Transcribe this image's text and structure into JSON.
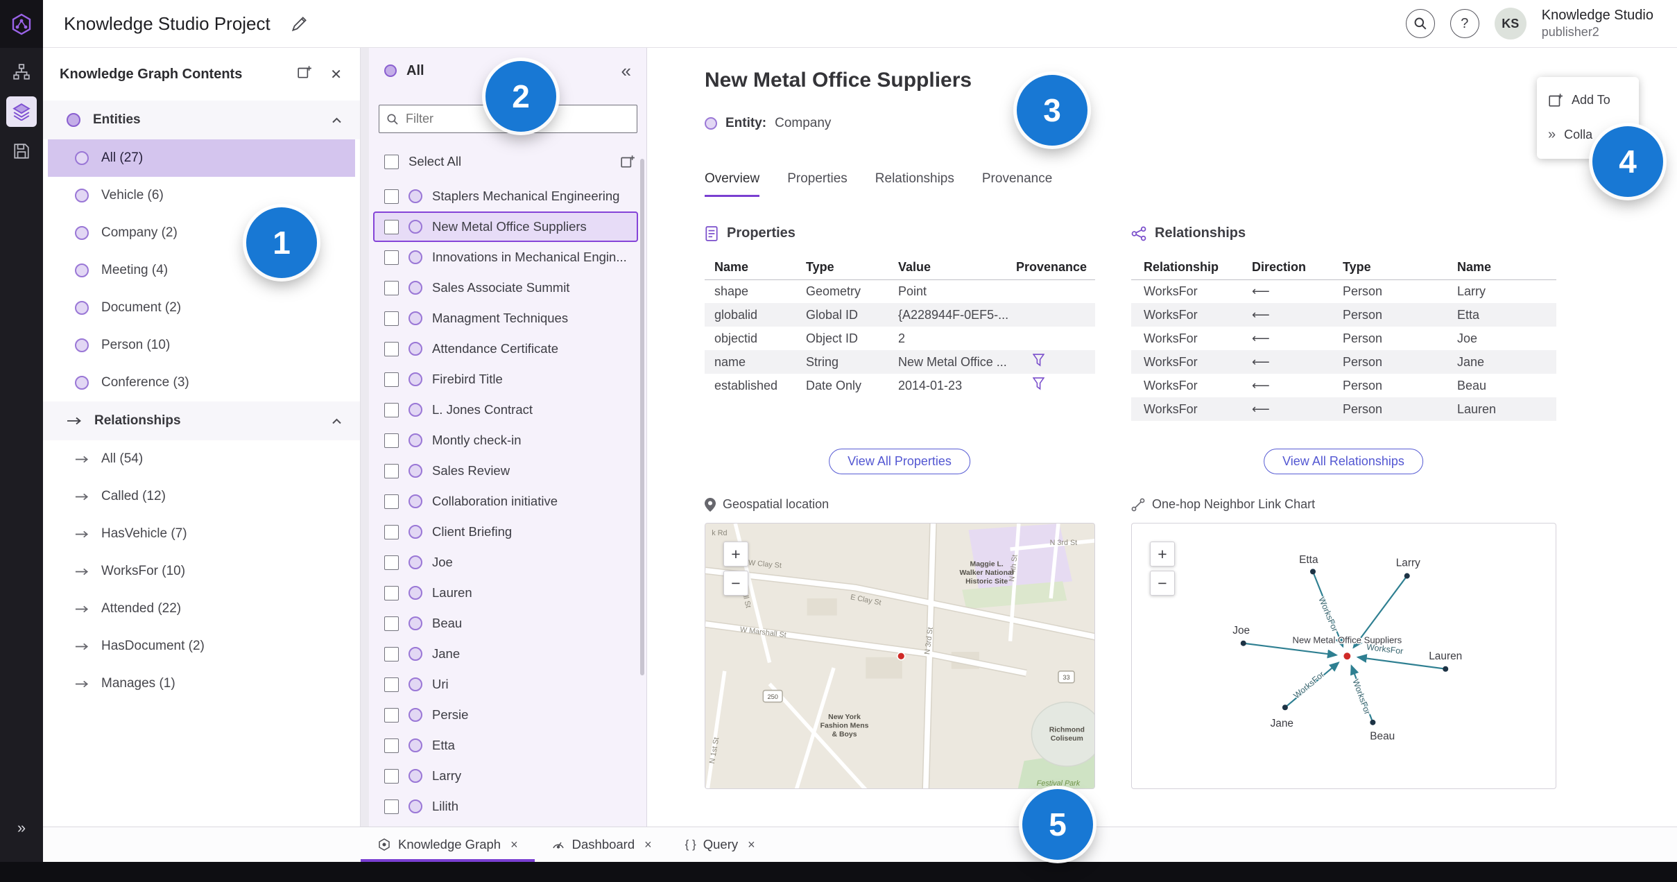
{
  "icons": {
    "collapse_left": "«",
    "expand_right": "»",
    "close": "✕",
    "help": "?",
    "zoom_in": "+",
    "zoom_out": "−",
    "tab_close": "×",
    "braces": "{ }"
  },
  "topbar": {
    "title": "Knowledge Studio Project",
    "avatar_initials": "KS",
    "user_name": "Knowledge Studio",
    "user_role": "publisher2"
  },
  "contents_panel": {
    "title": "Knowledge Graph Contents",
    "entities_label": "Entities",
    "entities": [
      {
        "label": "All (27)"
      },
      {
        "label": "Vehicle (6)"
      },
      {
        "label": "Company (2)"
      },
      {
        "label": "Meeting (4)"
      },
      {
        "label": "Document (2)"
      },
      {
        "label": "Person (10)"
      },
      {
        "label": "Conference (3)"
      }
    ],
    "relationships_label": "Relationships",
    "relationships": [
      {
        "label": "All (54)"
      },
      {
        "label": "Called (12)"
      },
      {
        "label": "HasVehicle (7)"
      },
      {
        "label": "WorksFor (10)"
      },
      {
        "label": "Attended (22)"
      },
      {
        "label": "HasDocument (2)"
      },
      {
        "label": "Manages (1)"
      }
    ]
  },
  "list_panel": {
    "header": "All",
    "filter_placeholder": "Filter",
    "select_all_label": "Select All",
    "items": [
      "Staplers Mechanical Engineering",
      "New Metal Office Suppliers",
      "Innovations in Mechanical Engin...",
      "Sales Associate Summit",
      "Managment Techniques",
      "Attendance Certificate",
      "Firebird Title",
      "L. Jones Contract",
      "Montly check-in",
      "Sales Review",
      "Collaboration initiative",
      "Client Briefing",
      "Joe",
      "Lauren",
      "Beau",
      "Jane",
      "Uri",
      "Persie",
      "Etta",
      "Larry",
      "Lilith"
    ]
  },
  "detail": {
    "title": "New Metal Office Suppliers",
    "entity_label": "Entity:",
    "entity_type": "Company",
    "tabs": [
      "Overview",
      "Properties",
      "Relationships",
      "Provenance"
    ],
    "actions": {
      "add_to": "Add To",
      "collapse": "Colla"
    },
    "properties": {
      "heading": "Properties",
      "columns": [
        "Name",
        "Type",
        "Value",
        "Provenance"
      ],
      "rows": [
        {
          "name": "shape",
          "type": "Geometry",
          "value": "Point"
        },
        {
          "name": "globalid",
          "type": "Global ID",
          "value": "{A228944F-0EF5-..."
        },
        {
          "name": "objectid",
          "type": "Object ID",
          "value": "2"
        },
        {
          "name": "name",
          "type": "String",
          "value": "New Metal Office ..."
        },
        {
          "name": "established",
          "type": "Date Only",
          "value": "2014-01-23"
        }
      ],
      "view_all_label": "View All Properties"
    },
    "relationships": {
      "heading": "Relationships",
      "columns": [
        "Relationship",
        "Direction",
        "Type",
        "Name"
      ],
      "rows": [
        {
          "relationship": "WorksFor",
          "direction": "⟵",
          "type": "Person",
          "name": "Larry"
        },
        {
          "relationship": "WorksFor",
          "direction": "⟵",
          "type": "Person",
          "name": "Etta"
        },
        {
          "relationship": "WorksFor",
          "direction": "⟵",
          "type": "Person",
          "name": "Joe"
        },
        {
          "relationship": "WorksFor",
          "direction": "⟵",
          "type": "Person",
          "name": "Jane"
        },
        {
          "relationship": "WorksFor",
          "direction": "⟵",
          "type": "Person",
          "name": "Beau"
        },
        {
          "relationship": "WorksFor",
          "direction": "⟵",
          "type": "Person",
          "name": "Lauren"
        }
      ],
      "view_all_label": "View All Relationships"
    },
    "geo_heading": "Geospatial location",
    "linkchart": {
      "heading": "One-hop Neighbor Link Chart",
      "center_label": "New Metal Office Suppliers",
      "edge_label": "WorksFor",
      "nodes": [
        "Etta",
        "Larry",
        "Joe",
        "Lauren",
        "Jane",
        "Beau"
      ]
    }
  },
  "map": {
    "labels": {
      "n3rd_top": "N 3rd St",
      "n3rd_mid": "N 3rd St",
      "n4th": "N 4th St",
      "wclay": "W Clay St",
      "eclay": "E Clay St",
      "wmarshall": "W Marshall St",
      "marshall": "Marshall St",
      "n1st": "N 1st St",
      "krd": "k Rd",
      "maggie1": "Maggie L.",
      "maggie2": "Walker National",
      "maggie3": "Historic Site",
      "shield250": "250",
      "shield33": "33",
      "nyf1": "New York",
      "nyf2": "Fashion Mens",
      "nyf3": "& Boys",
      "col1": "Richmond",
      "col2": "Coliseum",
      "festival": "Festival Park"
    }
  },
  "bottom_tabs": [
    {
      "label": "Knowledge Graph"
    },
    {
      "label": "Dashboard"
    },
    {
      "label": "Query"
    }
  ],
  "annotations": [
    "1",
    "2",
    "3",
    "4",
    "5"
  ]
}
